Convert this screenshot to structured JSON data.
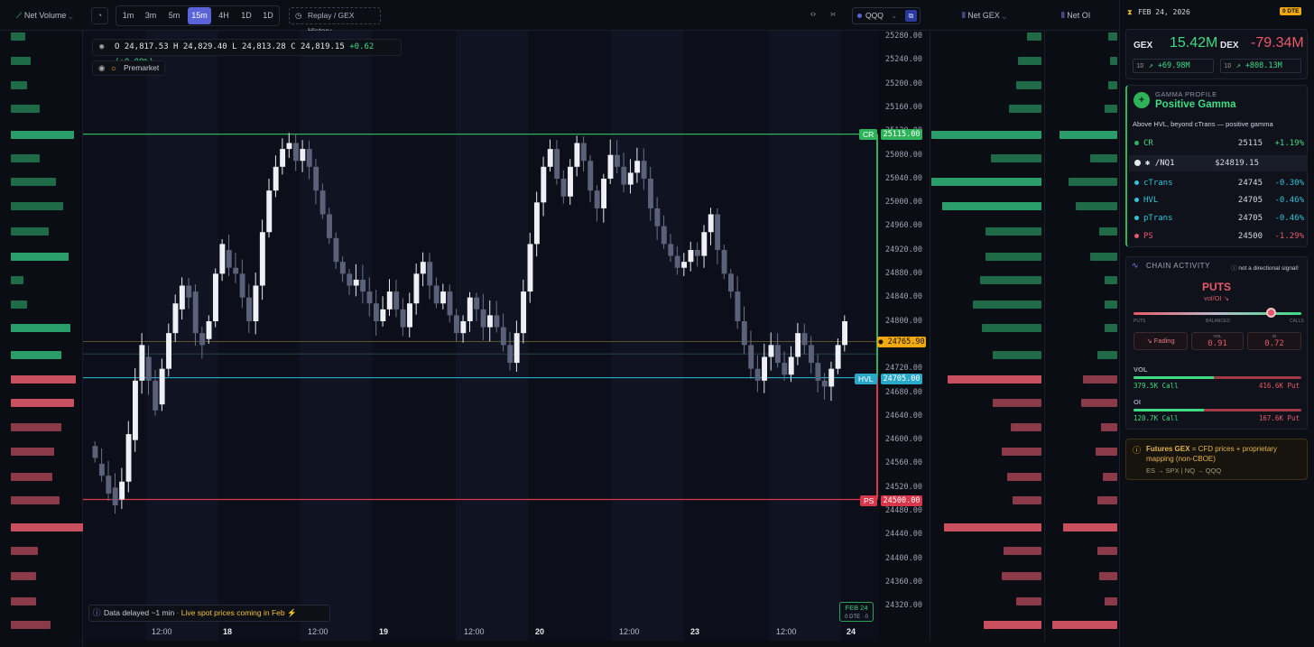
{
  "toolbar": {
    "volume_selector": "Net Volume",
    "timeframes": [
      "1m",
      "3m",
      "5m",
      "15m",
      "4H",
      "1D"
    ],
    "active_timeframe": "15m",
    "replay_label": "Replay / GEX History",
    "ticker": "QQQ",
    "gex_selector": "Net GEX",
    "oi_selector": "Net OI"
  },
  "ohlc": {
    "o": "24,817.53",
    "h": "24,829.40",
    "l": "24,813.28",
    "c": "24,819.15",
    "change": "+0.62 (+0.00%)"
  },
  "premarket_label": "Premarket",
  "price_axis": [
    "25280.00",
    "25240.00",
    "25200.00",
    "25160.00",
    "25120.00",
    "25080.00",
    "25040.00",
    "25000.00",
    "24960.00",
    "24920.00",
    "24880.00",
    "24840.00",
    "24800.00",
    "24760.00",
    "24720.00",
    "24680.00",
    "24640.00",
    "24600.00",
    "24560.00",
    "24520.00",
    "24480.00",
    "24440.00",
    "24400.00",
    "24360.00",
    "24320.00"
  ],
  "levels": {
    "cr": {
      "name": "CR",
      "price": "25115.00",
      "color": "#2fb35a"
    },
    "hvl": {
      "name": "HVL",
      "price": "24705.00",
      "color": "#2aa8c8"
    },
    "ps": {
      "name": "PS",
      "price": "24500.00",
      "color": "#d8364a"
    },
    "spot": {
      "price": "24765.90",
      "color": "#f0a90f"
    }
  },
  "x_labels": [
    "12:00",
    "18",
    "12:00",
    "19",
    "12:00",
    "20",
    "12:00",
    "23",
    "12:00",
    "24"
  ],
  "footer": {
    "delayed": "Data delayed ~1 min",
    "separator": "·",
    "live": "Live spot prices coming in Feb",
    "feb_box_date": "FEB 24",
    "feb_box_dte": "0 DTE · 0"
  },
  "right_panel": {
    "date": "FEB 24, 2026",
    "dte_badge": "0 DTE",
    "gex_label": "GEX",
    "gex_value": "15.42M",
    "gex_1d_tag": "1D",
    "gex_1d": "+69.98M",
    "dex_label": "DEX",
    "dex_value": "-79.34M",
    "dex_1d_tag": "1D",
    "dex_1d": "+808.13M",
    "gamma_profile_label": "GAMMA PROFILE",
    "gamma_profile_value": "Positive Gamma",
    "gamma_note": "Above HVL, beyond cTrans — positive gamma",
    "level_rows": [
      {
        "name": "CR",
        "price": "25115",
        "pct": "+1.19%"
      },
      {
        "name": "/NQ1",
        "price": "$24819.15",
        "pct": ""
      },
      {
        "name": "cTrans",
        "price": "24745",
        "pct": "-0.30%"
      },
      {
        "name": "HVL",
        "price": "24705",
        "pct": "-0.46%"
      },
      {
        "name": "pTrans",
        "price": "24705",
        "pct": "-0.46%"
      },
      {
        "name": "PS",
        "price": "24500",
        "pct": "-1.29%"
      }
    ],
    "chain_activity_label": "CHAIN ACTIVITY",
    "chain_note": "not a directional signal!",
    "puts_label": "PUTS",
    "vol_oi_label": "vol/OI",
    "slider_puts": "PUTS",
    "slider_balanced": "BALANCED",
    "slider_calls": "CALLS",
    "slider_position": 0.82,
    "fading_label": "Fading",
    "vol_tag": "VOL",
    "vol_ratio": "0.91",
    "oi_tag": "OI",
    "oi_ratio": "0.72",
    "vol_label": "VOL",
    "vol_call": "379.5K Call",
    "vol_put": "416.6K Put",
    "vol_call_share": 0.477,
    "oi_label": "OI",
    "oi_call": "120.7K Call",
    "oi_put": "167.6K Put",
    "oi_call_share": 0.419,
    "futures_title": "Futures GEX",
    "futures_text": "= CFD prices + proprietary mapping (non-CBOE)",
    "futures_map": "ES → SPX | NQ → QQQ"
  },
  "colors": {
    "green": "#3ddc84",
    "red": "#e85a6a",
    "accent": "#5b63d9"
  }
}
